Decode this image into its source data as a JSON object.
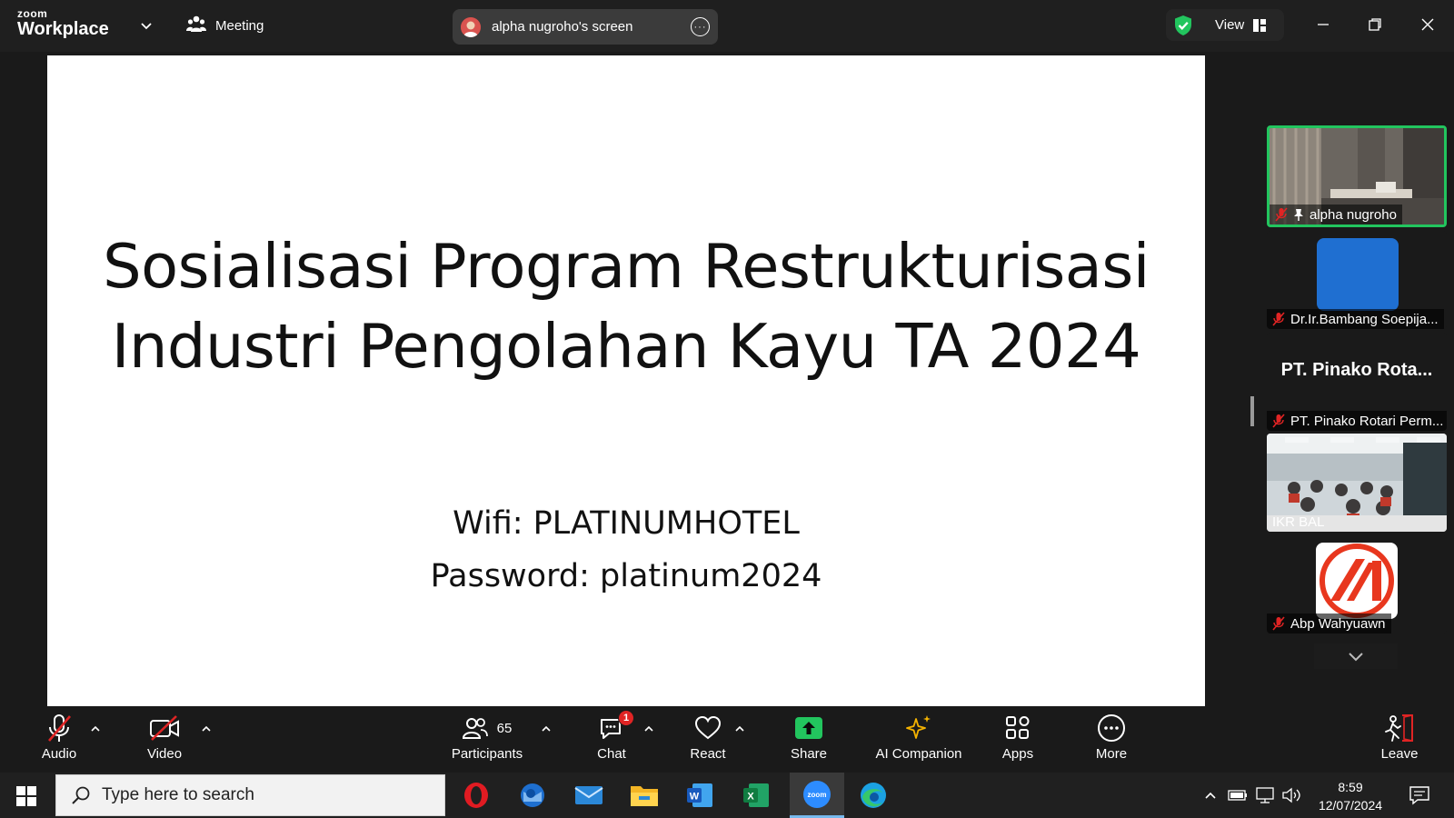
{
  "app": {
    "logo_small": "zoom",
    "logo_big": "Workplace",
    "meeting_label": "Meeting",
    "share_banner": "alpha nugroho's screen",
    "view_label": "View",
    "security_color": "#22c55e"
  },
  "slide": {
    "title_line1": "Sosialisasi Program Restrukturisasi",
    "title_line2": "Industri Pengolahan Kayu TA 2024",
    "wifi": "Wifi: PLATINUMHOTEL",
    "password": "Password: platinum2024"
  },
  "participants": [
    {
      "name": "alpha nugroho",
      "muted": true,
      "pinned": true,
      "active": true,
      "tile": "video-room"
    },
    {
      "name": "Dr.Ir.Bambang Soepija...",
      "muted": true,
      "tile": "avatar-blue"
    },
    {
      "name": "PT. Pinako Rotari Perm...",
      "display_text": "PT. Pinako Rota...",
      "muted": true,
      "tile": "name-card"
    },
    {
      "name": "IKR BAL",
      "muted": false,
      "tile": "video-meeting-hall"
    },
    {
      "name": "Abp Wahyuawn",
      "muted": true,
      "tile": "logo-avatar"
    }
  ],
  "toolbar": {
    "audio": "Audio",
    "video": "Video",
    "participants": "Participants",
    "participants_count": "65",
    "chat": "Chat",
    "chat_badge": "1",
    "react": "React",
    "share": "Share",
    "ai_companion": "AI Companion",
    "apps": "Apps",
    "more": "More",
    "leave": "Leave"
  },
  "taskbar": {
    "search_placeholder": "Type here to search",
    "apps": [
      "opera-icon",
      "outlook-icon",
      "mail-icon",
      "file-explorer-icon",
      "word-icon",
      "excel-icon",
      "zoom-icon",
      "edge-icon"
    ],
    "time": "8:59",
    "date": "12/07/2024"
  }
}
